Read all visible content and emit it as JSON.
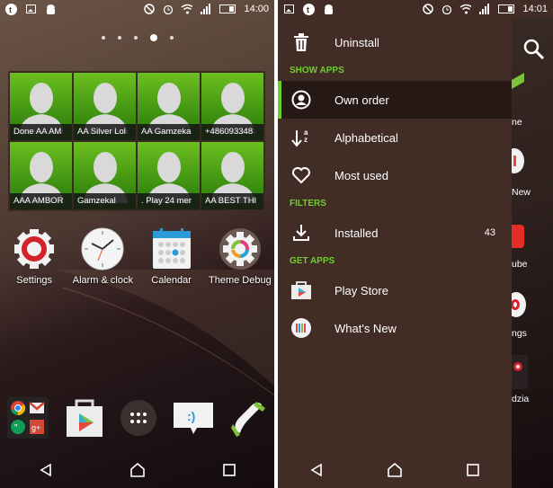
{
  "left_screen": {
    "status_bar": {
      "time": "14:00",
      "left_icons": [
        "tumblr-icon",
        "image-icon",
        "android-icon"
      ],
      "right_icons": [
        "do-not-disturb-icon",
        "alarm-icon",
        "wifi-icon",
        "signal-icon",
        "battery-icon"
      ]
    },
    "page_indicator": {
      "pages": 5,
      "current": 4
    },
    "contacts_widget": {
      "contacts": [
        "Done AA AM",
        "AA Silver Lol",
        "AA  Gamzeka",
        "+486093348",
        "AAA AMBOR",
        "Gamzekal",
        ". Play 24 mer",
        "AA BEST THI"
      ]
    },
    "apps": [
      {
        "label": "Settings",
        "icon": "settings-icon"
      },
      {
        "label": "Alarm & clock",
        "icon": "clock-icon"
      },
      {
        "label": "Calendar",
        "icon": "calendar-icon"
      },
      {
        "label": "Theme Debug",
        "icon": "theme-debug-icon"
      }
    ],
    "dock": [
      {
        "name": "google-folder",
        "icon": "google-folder-icon"
      },
      {
        "name": "play-store",
        "icon": "play-store-icon"
      },
      {
        "name": "app-drawer",
        "icon": "app-drawer-icon"
      },
      {
        "name": "messaging",
        "icon": "messaging-icon"
      },
      {
        "name": "phone",
        "icon": "phone-icon"
      }
    ]
  },
  "right_screen": {
    "status_bar": {
      "time": "14:01"
    },
    "drawer": {
      "uninstall": "Uninstall",
      "sections": {
        "show_apps": "SHOW APPS",
        "filters": "FILTERS",
        "get_apps": "GET APPS"
      },
      "show_apps_items": [
        {
          "label": "Own order",
          "selected": true
        },
        {
          "label": "Alphabetical",
          "selected": false
        },
        {
          "label": "Most used",
          "selected": false
        }
      ],
      "filters_items": [
        {
          "label": "Installed",
          "count": "43"
        }
      ],
      "get_apps_items": [
        {
          "label": "Play Store"
        },
        {
          "label": "What's New"
        }
      ]
    },
    "behind_labels": [
      "ne",
      "New",
      "ube",
      "ngs",
      "dzia"
    ]
  },
  "colors": {
    "accent": "#6bd02b",
    "drawer_bg": "#412c26",
    "selected_bg": "#261915"
  }
}
